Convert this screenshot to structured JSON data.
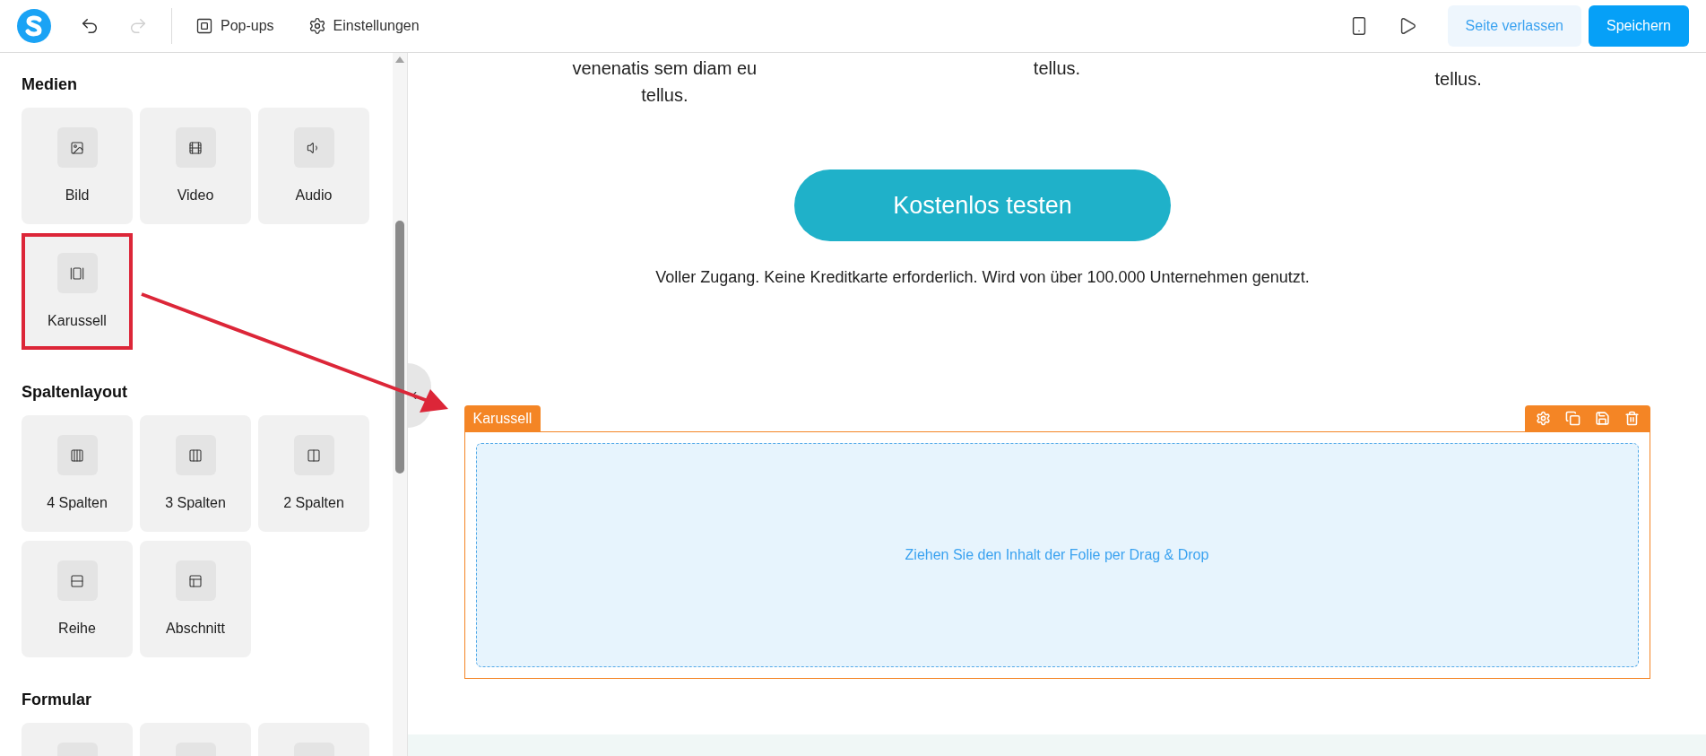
{
  "toolbar": {
    "history": [
      {
        "kind": "undo",
        "disabled": false
      },
      {
        "kind": "redo",
        "disabled": true
      }
    ],
    "menu": [
      {
        "kind": "popups",
        "label": "Pop-ups"
      },
      {
        "kind": "settings",
        "label": "Einstellungen"
      }
    ],
    "tools": [
      {
        "kind": "mobile"
      },
      {
        "kind": "preview"
      }
    ],
    "actions": [
      {
        "kind": "secondary",
        "label": "Seite verlassen"
      },
      {
        "kind": "primary",
        "label": "Speichern"
      }
    ]
  },
  "sidebar": {
    "sections": [
      {
        "title": "Medien",
        "items": [
          {
            "kind": "image",
            "label": "Bild",
            "highlighted": false
          },
          {
            "kind": "film",
            "label": "Video",
            "highlighted": false
          },
          {
            "kind": "speaker",
            "label": "Audio",
            "highlighted": false
          },
          {
            "kind": "carousel",
            "label": "Karussell",
            "highlighted": true
          }
        ]
      },
      {
        "title": "Spaltenlayout",
        "items": [
          {
            "kind": "cols4",
            "label": "4 Spalten",
            "highlighted": false
          },
          {
            "kind": "cols3",
            "label": "3 Spalten",
            "highlighted": false
          },
          {
            "kind": "cols2",
            "label": "2 Spalten",
            "highlighted": false
          },
          {
            "kind": "row",
            "label": "Reihe",
            "highlighted": false
          },
          {
            "kind": "section",
            "label": "Abschnitt",
            "highlighted": false
          }
        ]
      },
      {
        "title": "Formular",
        "items": [
          {
            "kind": "blank",
            "highlighted": false
          },
          {
            "kind": "blank",
            "highlighted": false
          },
          {
            "kind": "blank",
            "highlighted": false
          }
        ]
      }
    ]
  },
  "canvas": {
    "text_columns": [
      [
        "venenatis sem diam eu",
        "tellus."
      ],
      [
        "tellus."
      ],
      [
        "tellus."
      ]
    ],
    "cta_button": "Kostenlos testen",
    "note": "Voller Zugang. Keine Kreditkarte erforderlich. Wird von über 100.000 Unternehmen genutzt.",
    "carousel": {
      "label": "Karussell",
      "hint": "Ziehen Sie den Inhalt der Folie per Drag & Drop",
      "tools": [
        {
          "kind": "settings"
        },
        {
          "kind": "copy"
        },
        {
          "kind": "save"
        },
        {
          "kind": "delete"
        }
      ]
    }
  }
}
